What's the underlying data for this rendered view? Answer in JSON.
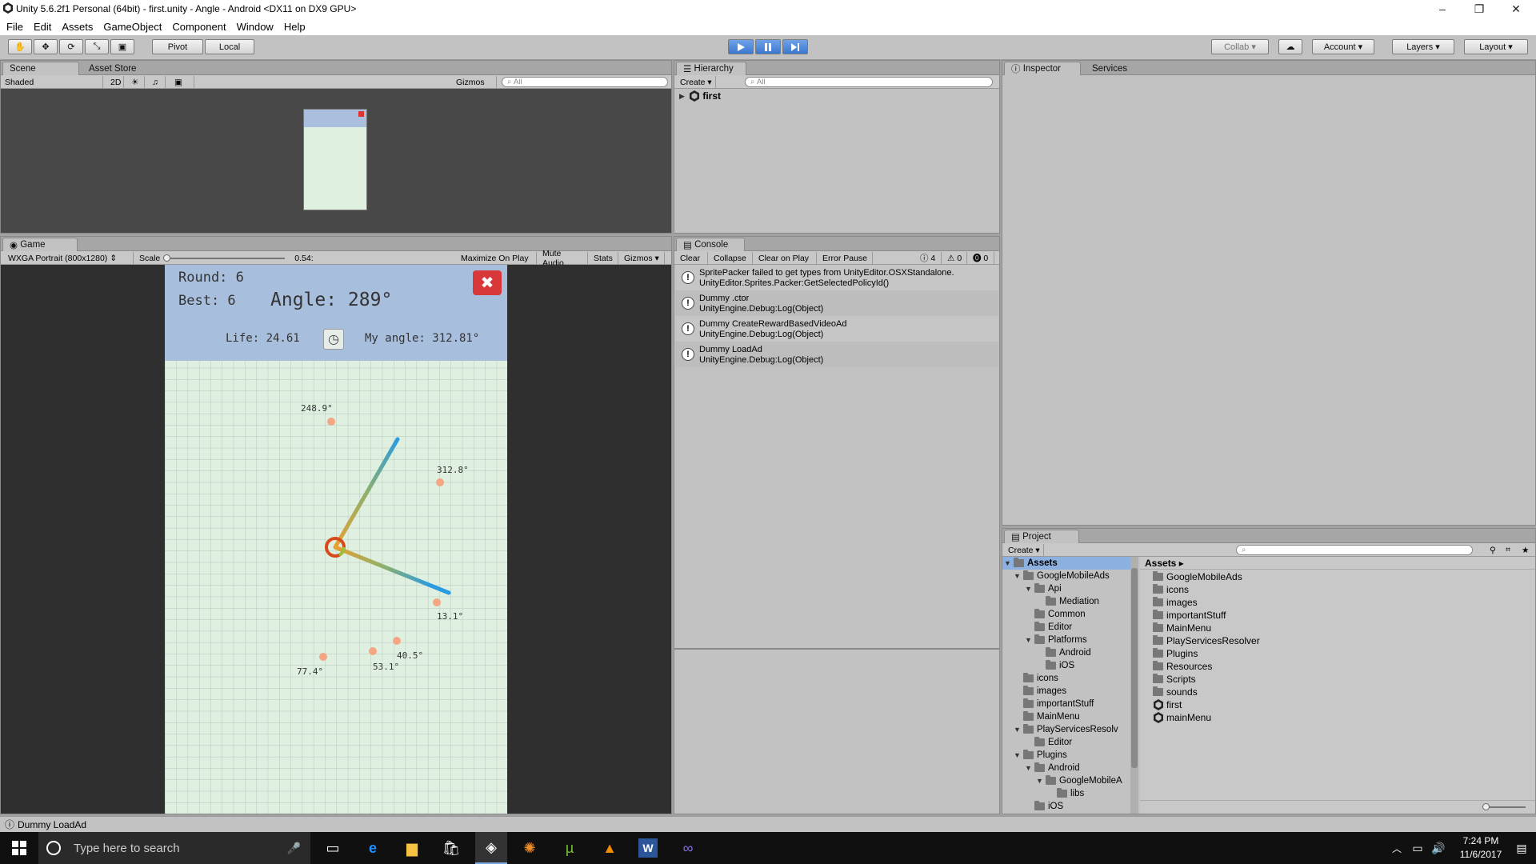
{
  "window": {
    "title": "Unity 5.6.2f1 Personal (64bit) - first.unity - Angle - Android <DX11 on DX9 GPU>",
    "controls": [
      "–",
      "❐",
      "✕"
    ]
  },
  "menu": [
    "File",
    "Edit",
    "Assets",
    "GameObject",
    "Component",
    "Window",
    "Help"
  ],
  "toolbar": {
    "transform_tools": [
      "hand",
      "move",
      "rotate",
      "scale",
      "rect"
    ],
    "pivot_label": "Pivot",
    "local_label": "Local",
    "collab_label": "Collab",
    "account_label": "Account",
    "layers_label": "Layers",
    "layout_label": "Layout"
  },
  "scene": {
    "tabs": [
      "Scene",
      "Asset Store"
    ],
    "shading": "Shaded",
    "mode_2d": "2D",
    "gizmos": "Gizmos",
    "search_placeholder": "All"
  },
  "hierarchy": {
    "tab": "Hierarchy",
    "create": "Create",
    "search_placeholder": "All",
    "scene_name": "first"
  },
  "inspector": {
    "tabs": [
      "Inspector",
      "Services"
    ]
  },
  "game": {
    "tab": "Game",
    "resolution": "WXGA Portrait (800x1280)",
    "scale_label": "Scale",
    "scale_value": "0.54:",
    "buttons": [
      "Maximize On Play",
      "Mute Audio",
      "Stats",
      "Gizmos"
    ],
    "hud": {
      "round": "Round: 6",
      "best": "Best: 6",
      "angle": "Angle: 289°",
      "life": "Life: 24.61",
      "my_angle": "My angle: 312.81°"
    },
    "markers": [
      {
        "label": "248.9°"
      },
      {
        "label": "312.8°"
      },
      {
        "label": "13.1°"
      },
      {
        "label": "40.5°"
      },
      {
        "label": "53.1°"
      },
      {
        "label": "77.4°"
      }
    ]
  },
  "console": {
    "tab": "Console",
    "buttons": [
      "Clear",
      "Collapse",
      "Clear on Play",
      "Error Pause"
    ],
    "counts": {
      "log": "4",
      "warn": "0",
      "error": "0"
    },
    "entries": [
      {
        "l1": "SpritePacker failed to get types from UnityEditor.OSXStandalone.",
        "l2": "UnityEditor.Sprites.Packer:GetSelectedPolicyId()"
      },
      {
        "l1": "Dummy .ctor",
        "l2": "UnityEngine.Debug:Log(Object)"
      },
      {
        "l1": "Dummy CreateRewardBasedVideoAd",
        "l2": "UnityEngine.Debug:Log(Object)"
      },
      {
        "l1": "Dummy LoadAd",
        "l2": "UnityEngine.Debug:Log(Object)"
      }
    ]
  },
  "project": {
    "tab": "Project",
    "create": "Create",
    "breadcrumb": "Assets",
    "tree": [
      {
        "label": "Assets",
        "arrow": "▼"
      },
      {
        "label": "GoogleMobileAds",
        "arrow": "▼"
      },
      {
        "label": "Api",
        "arrow": "▼"
      },
      {
        "label": "Mediation",
        "arrow": ""
      },
      {
        "label": "Common",
        "arrow": ""
      },
      {
        "label": "Editor",
        "arrow": ""
      },
      {
        "label": "Platforms",
        "arrow": "▼"
      },
      {
        "label": "Android",
        "arrow": ""
      },
      {
        "label": "iOS",
        "arrow": ""
      },
      {
        "label": "icons",
        "arrow": ""
      },
      {
        "label": "images",
        "arrow": ""
      },
      {
        "label": "importantStuff",
        "arrow": ""
      },
      {
        "label": "MainMenu",
        "arrow": ""
      },
      {
        "label": "PlayServicesResolv",
        "arrow": "▼"
      },
      {
        "label": "Editor",
        "arrow": ""
      },
      {
        "label": "Plugins",
        "arrow": "▼"
      },
      {
        "label": "Android",
        "arrow": "▼"
      },
      {
        "label": "GoogleMobileA",
        "arrow": "▼"
      },
      {
        "label": "libs",
        "arrow": ""
      },
      {
        "label": "iOS",
        "arrow": ""
      }
    ],
    "assets": [
      {
        "label": "GoogleMobileAds",
        "kind": "folder"
      },
      {
        "label": "icons",
        "kind": "folder"
      },
      {
        "label": "images",
        "kind": "folder"
      },
      {
        "label": "importantStuff",
        "kind": "folder"
      },
      {
        "label": "MainMenu",
        "kind": "folder"
      },
      {
        "label": "PlayServicesResolver",
        "kind": "folder"
      },
      {
        "label": "Plugins",
        "kind": "folder"
      },
      {
        "label": "Resources",
        "kind": "folder"
      },
      {
        "label": "Scripts",
        "kind": "folder"
      },
      {
        "label": "sounds",
        "kind": "folder"
      },
      {
        "label": "first",
        "kind": "scene"
      },
      {
        "label": "mainMenu",
        "kind": "scene"
      }
    ]
  },
  "statusbar": {
    "text": "Dummy LoadAd"
  },
  "taskbar": {
    "search_placeholder": "Type here to search",
    "time": "7:24 PM",
    "date": "11/6/2017"
  }
}
